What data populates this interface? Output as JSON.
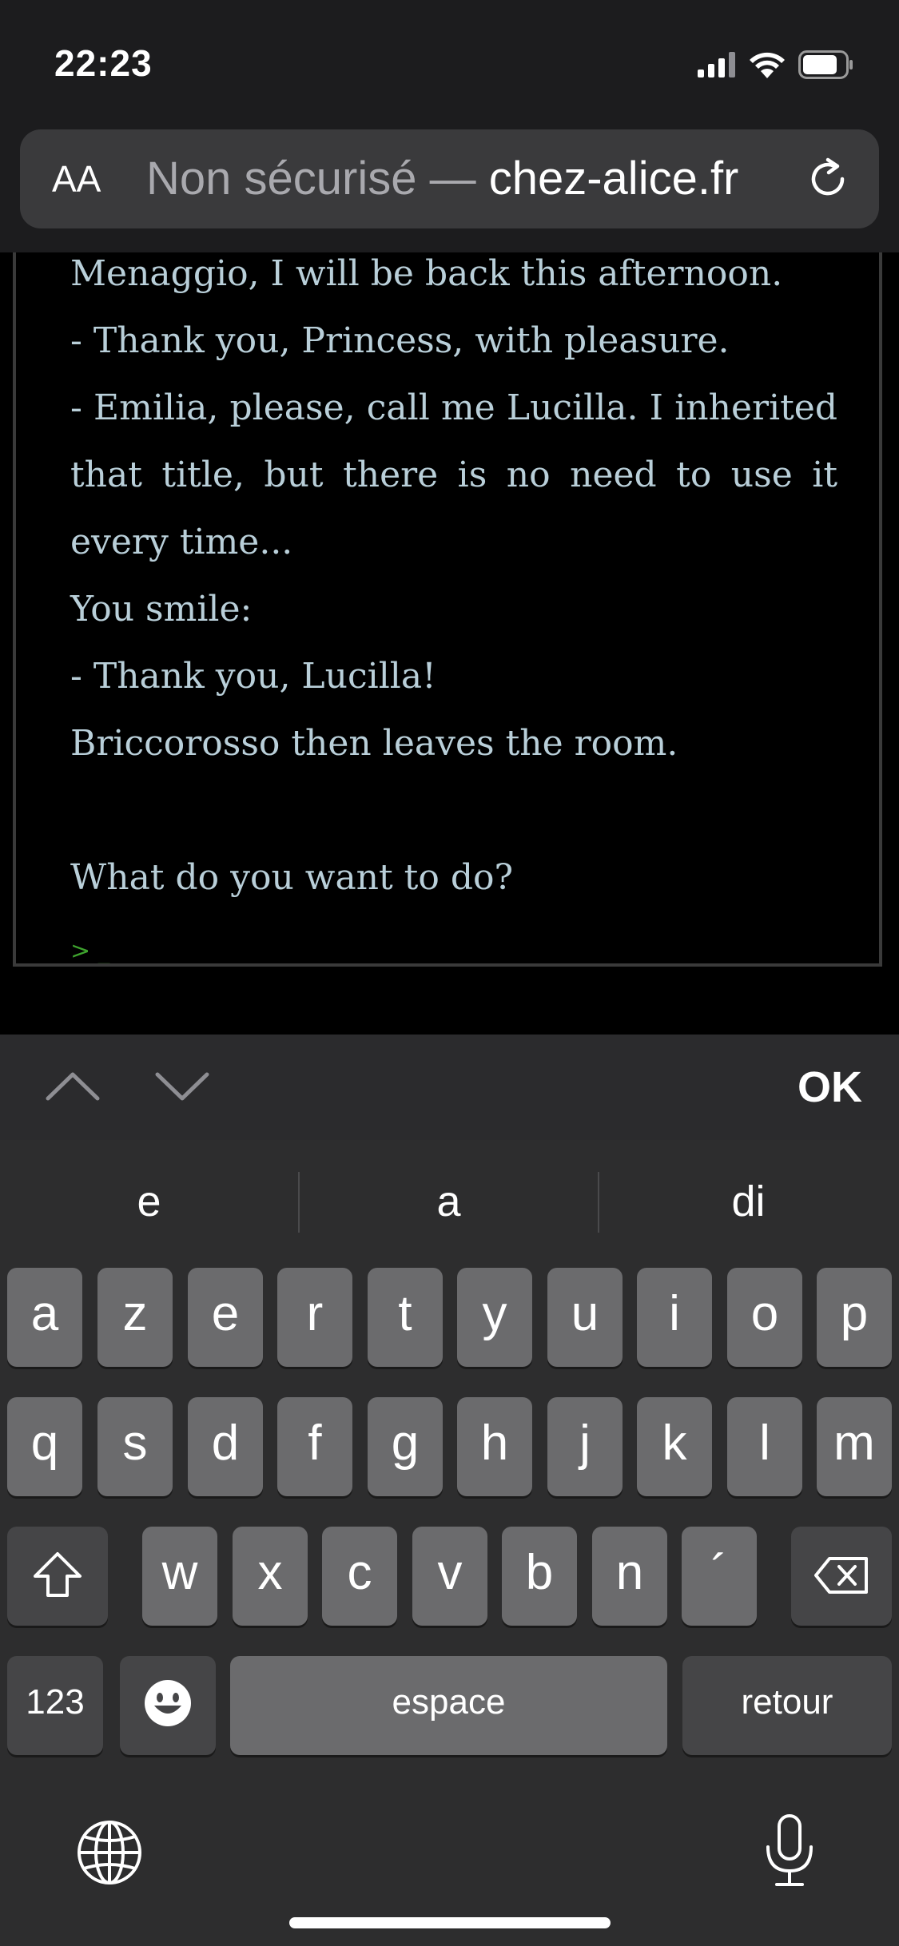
{
  "status_bar": {
    "time": "22:23"
  },
  "browser": {
    "text_size_button": "AA",
    "url_prefix": "Non sécurisé — ",
    "url_domain": "chez-alice.fr"
  },
  "story": {
    "lines": [
      "Menaggio, I will be back this afternoon.",
      "- Thank you, Princess, with pleasure.",
      "- Emilia, please, call me Lucilla. I inherited that title, but there is no need to use it every time...",
      "You smile:",
      "- Thank you, Lucilla!",
      "Briccorosso then leaves the room.",
      "",
      "What do you want to do?"
    ],
    "prompt": "> _"
  },
  "accessory_bar": {
    "done_label": "OK"
  },
  "suggestions": [
    "e",
    "a",
    "di"
  ],
  "keyboard": {
    "row1": [
      "a",
      "z",
      "e",
      "r",
      "t",
      "y",
      "u",
      "i",
      "o",
      "p"
    ],
    "row2": [
      "q",
      "s",
      "d",
      "f",
      "g",
      "h",
      "j",
      "k",
      "l",
      "m"
    ],
    "row3": [
      "w",
      "x",
      "c",
      "v",
      "b",
      "n",
      "´"
    ],
    "numbers_label": "123",
    "space_label": "espace",
    "return_label": "retour"
  },
  "colors": {
    "story_text": "#b9cfd9",
    "prompt": "#3ea32e",
    "key": "#6b6b6d"
  },
  "icons": [
    "signal-icon",
    "wifi-icon",
    "battery-icon",
    "reload-icon",
    "chevron-up-icon",
    "chevron-down-icon",
    "shift-icon",
    "delete-icon",
    "emoji-icon",
    "globe-icon",
    "microphone-icon"
  ]
}
